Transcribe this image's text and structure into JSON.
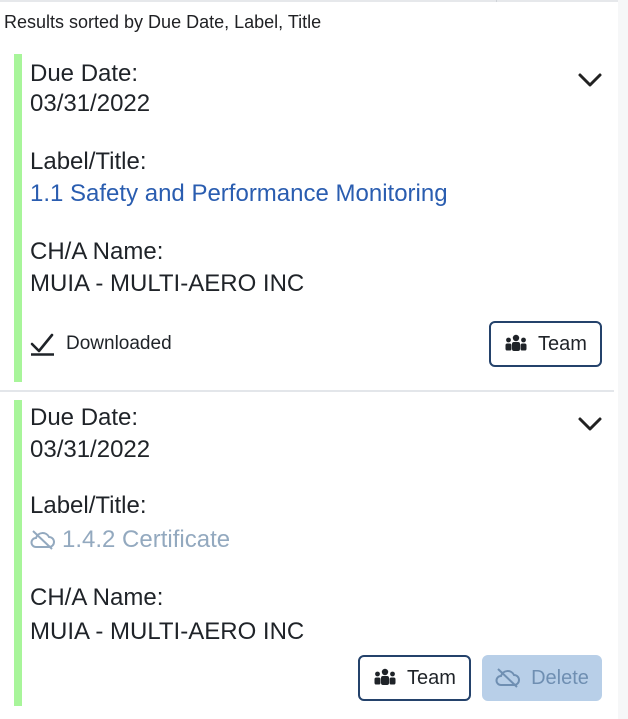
{
  "header": {
    "sort_text": "Results sorted by Due Date, Label, Title"
  },
  "cards": [
    {
      "due_label": "Due Date:",
      "due_value": "03/31/2022",
      "title_label": "Label/Title:",
      "title_value": "1.1 Safety and Performance Monitoring",
      "name_label": "CH/A Name:",
      "name_value": "MUIA - MULTI-AERO INC",
      "status": "Downloaded",
      "team_button": "Team"
    },
    {
      "due_label": "Due Date:",
      "due_value": "03/31/2022",
      "title_label": "Label/Title:",
      "title_value": "1.4.2 Certificate",
      "name_label": "CH/A Name:",
      "name_value": "MUIA - MULTI-AERO INC",
      "team_button": "Team",
      "delete_button": "Delete"
    }
  ],
  "colors": {
    "accent_bar": "#a8f59a",
    "link": "#2a5db0",
    "link_disabled": "#93a9bf",
    "button_border": "#24426b",
    "button_disabled_bg": "#b8cfe8"
  },
  "icons": {
    "expand": "chevron-down-icon",
    "status": "checkmark-icon",
    "team": "team-icon",
    "offline": "cloud-off-icon"
  }
}
